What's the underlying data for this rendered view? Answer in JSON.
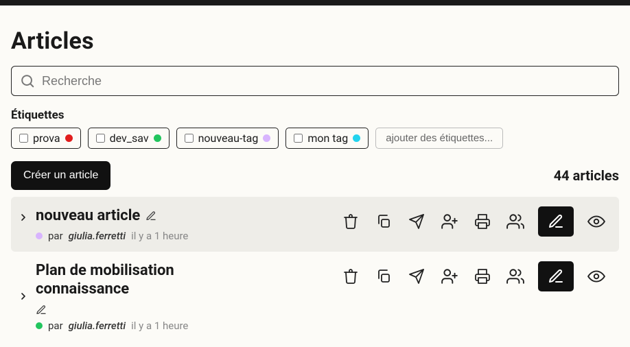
{
  "page": {
    "title": "Articles"
  },
  "search": {
    "placeholder": "Recherche"
  },
  "tags": {
    "section_label": "Étiquettes",
    "items": [
      {
        "label": "prova",
        "color": "#e11d1d"
      },
      {
        "label": "dev_sav",
        "color": "#22c55e"
      },
      {
        "label": "nouveau-tag",
        "color": "#d8b4fe"
      },
      {
        "label": "mon tag",
        "color": "#22d3ee"
      }
    ],
    "add_label": "ajouter des étiquettes..."
  },
  "toolbar": {
    "create_label": "Créer un article"
  },
  "summary": {
    "count_label": "44 articles"
  },
  "meta": {
    "by_prefix": "par"
  },
  "articles": [
    {
      "title": "nouveau article",
      "author": "giulia.ferretti",
      "time": "il y a 1 heure",
      "dot_color": "#d8b4fe",
      "selected": true
    },
    {
      "title": "Plan de mobilisation connaissance",
      "author": "giulia.ferretti",
      "time": "il y a 1 heure",
      "dot_color": "#22c55e",
      "selected": false
    }
  ]
}
